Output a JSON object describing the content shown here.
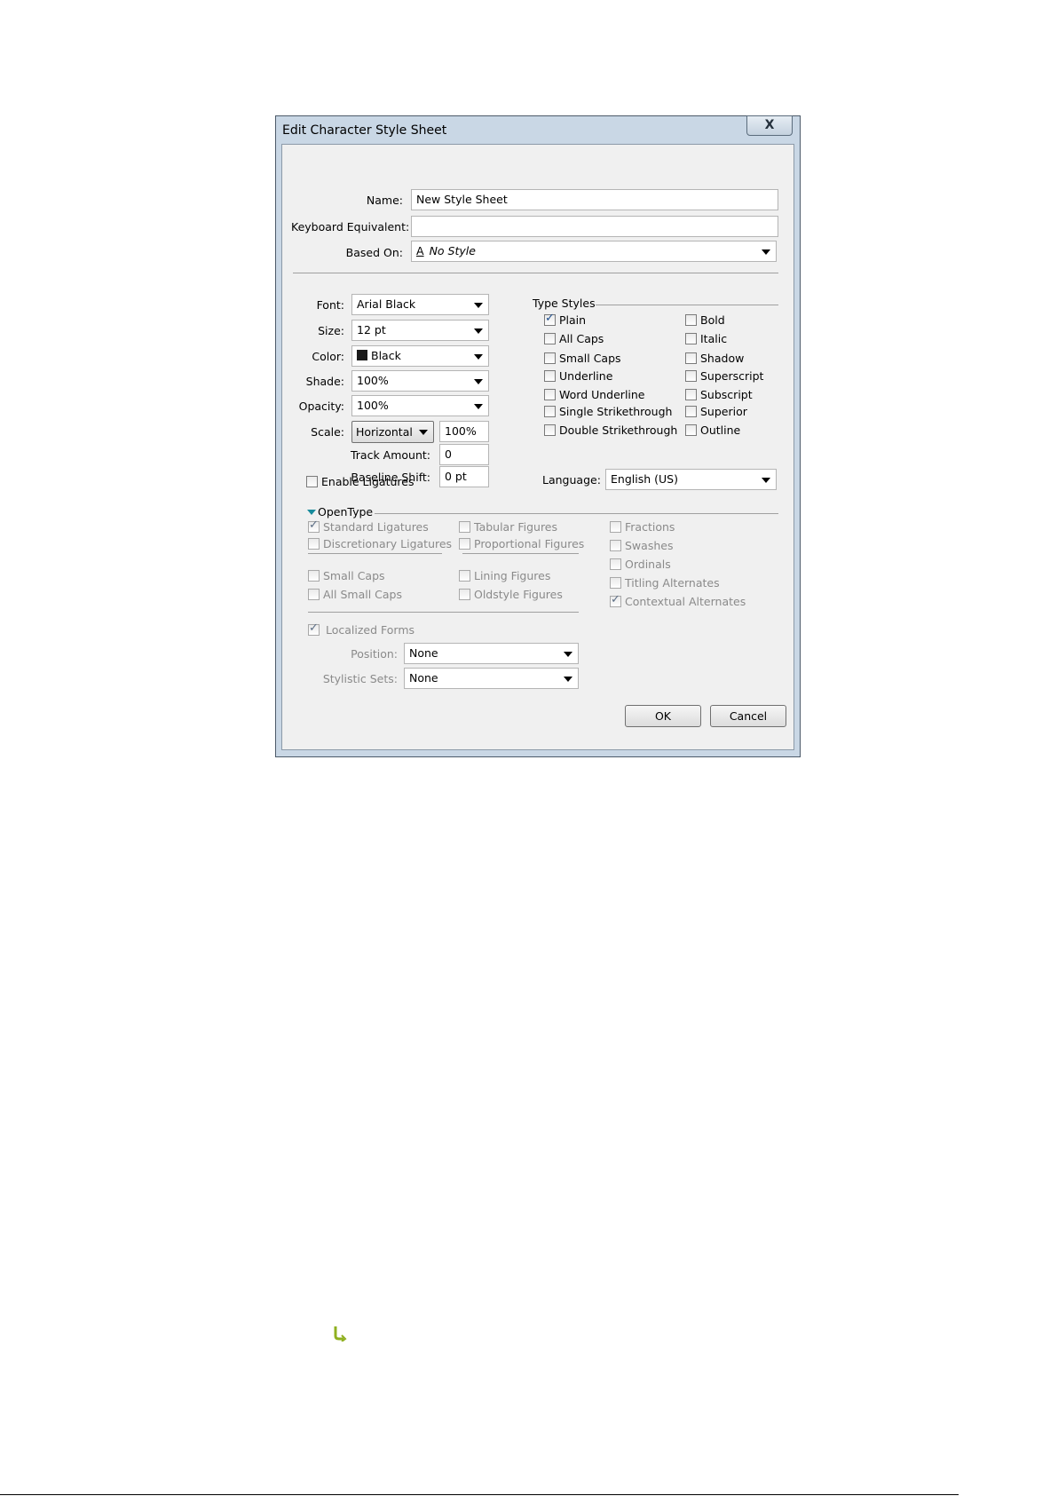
{
  "window": {
    "title": "Edit Character Style Sheet",
    "close_label": "X"
  },
  "top": {
    "name_label": "Name:",
    "name_value": "New Style Sheet",
    "keyboard_label": "Keyboard Equivalent:",
    "keyboard_value": "",
    "based_on_label": "Based On:",
    "based_on_icon": "A",
    "based_on_value": "No Style"
  },
  "char": {
    "font_label": "Font:",
    "font_value": "Arial Black",
    "size_label": "Size:",
    "size_value": "12 pt",
    "color_label": "Color:",
    "color_value": "Black",
    "color_swatch": "#1a1a1a",
    "shade_label": "Shade:",
    "shade_value": "100%",
    "opacity_label": "Opacity:",
    "opacity_value": "100%",
    "scale_label": "Scale:",
    "scale_mode": "Horizontal",
    "scale_value": "100%",
    "track_label": "Track Amount:",
    "track_value": "0",
    "baseline_label": "Baseline Shift:",
    "baseline_value": "0 pt"
  },
  "type_styles": {
    "title": "Type Styles",
    "left": [
      {
        "label": "Plain",
        "checked": true
      },
      {
        "label": "All Caps",
        "checked": false
      },
      {
        "label": "Small Caps",
        "checked": false
      },
      {
        "label": "Underline",
        "checked": false
      },
      {
        "label": "Word Underline",
        "checked": false
      },
      {
        "label": "Single Strikethrough",
        "checked": false
      },
      {
        "label": "Double Strikethrough",
        "checked": false
      }
    ],
    "right": [
      {
        "label": "Bold",
        "checked": false
      },
      {
        "label": "Italic",
        "checked": false
      },
      {
        "label": "Shadow",
        "checked": false
      },
      {
        "label": "Superscript",
        "checked": false
      },
      {
        "label": "Subscript",
        "checked": false
      },
      {
        "label": "Superior",
        "checked": false
      },
      {
        "label": "Outline",
        "checked": false
      }
    ]
  },
  "ligatures": {
    "label": "Enable Ligatures",
    "checked": false
  },
  "language": {
    "label": "Language:",
    "value": "English (US)"
  },
  "opentype": {
    "title": "OpenType",
    "col1": [
      {
        "label": "Standard Ligatures",
        "checked": true
      },
      {
        "label": "Discretionary Ligatures",
        "checked": false
      },
      {
        "label": "Small Caps",
        "checked": false
      },
      {
        "label": "All Small Caps",
        "checked": false
      }
    ],
    "col2": [
      {
        "label": "Tabular Figures",
        "checked": false
      },
      {
        "label": "Proportional Figures",
        "checked": false
      },
      {
        "label": "Lining Figures",
        "checked": false
      },
      {
        "label": "Oldstyle Figures",
        "checked": false
      }
    ],
    "col3": [
      {
        "label": "Fractions",
        "checked": false
      },
      {
        "label": "Swashes",
        "checked": false
      },
      {
        "label": "Ordinals",
        "checked": false
      },
      {
        "label": "Titling Alternates",
        "checked": false
      },
      {
        "label": "Contextual Alternates",
        "checked": true
      }
    ],
    "localized": {
      "label": "Localized Forms",
      "checked": true
    },
    "position_label": "Position:",
    "position_value": "None",
    "stylistic_label": "Stylistic Sets:",
    "stylistic_value": "None"
  },
  "buttons": {
    "ok": "OK",
    "cancel": "Cancel"
  }
}
